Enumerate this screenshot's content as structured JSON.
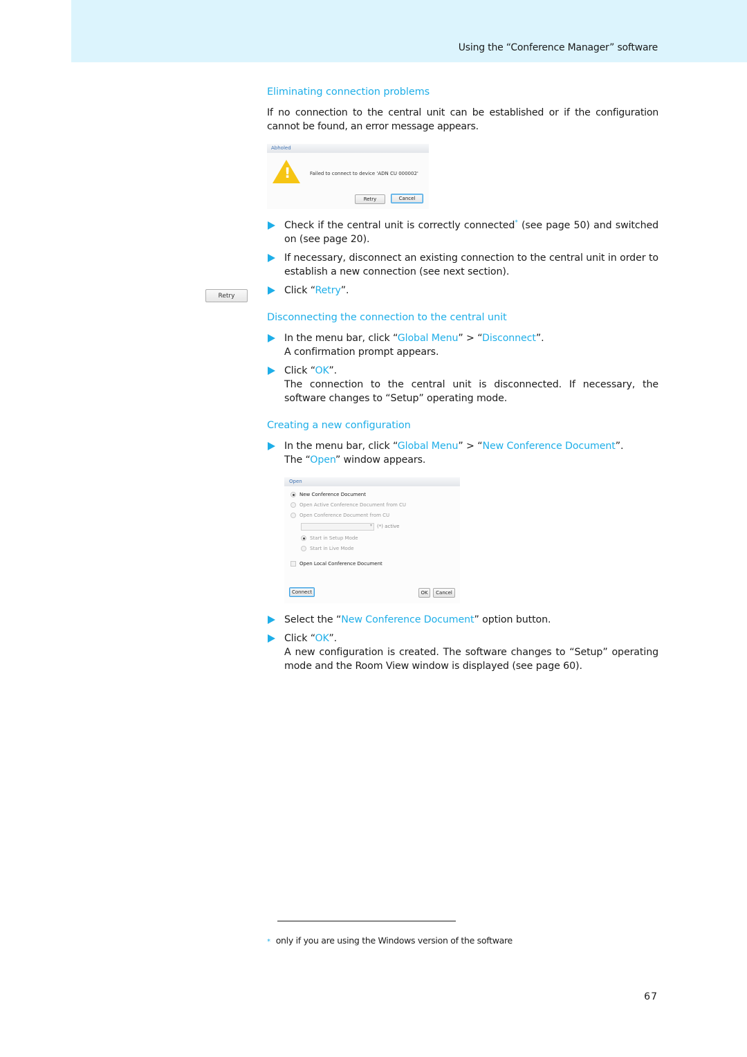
{
  "header": {
    "title": "Using the “Conference Manager” software"
  },
  "section1": {
    "heading": "Eliminating connection problems",
    "intro": "If no connection to the central unit can be established or if the configuration cannot be found, an error message appears.",
    "dialog": {
      "title": "Abholed",
      "message": "Failed to connect to device 'ADN CU 000002'",
      "retry_label": "Retry",
      "cancel_label": "Cancel"
    },
    "steps": [
      {
        "pre": "Check if the central unit is correctly connected",
        "sup": "*",
        "post": " (see page 50) and switched on (see page 20)."
      },
      {
        "text": "If necessary, disconnect an existing connection to the central unit in order to establish a new connection (see next section)."
      },
      {
        "pre": "Click “",
        "link": "Retry",
        "post": "”."
      }
    ],
    "margin_button": "Retry"
  },
  "section2": {
    "heading": "Disconnecting the connection to the central unit",
    "steps": [
      {
        "pre": "In the menu bar, click “",
        "link1": "Global Menu",
        "mid": "” > “",
        "link2": "Disconnect",
        "post": "”.",
        "result": "A confirmation prompt appears."
      },
      {
        "pre": "Click “",
        "link": "OK",
        "post": "”.",
        "result": "The connection to the central unit is disconnected. If necessary, the software changes to “Setup” operating mode."
      }
    ]
  },
  "section3": {
    "heading": "Creating a new configuration",
    "steps": [
      {
        "pre": "In the menu bar, click “",
        "link1": "Global Menu",
        "mid": "” > “",
        "link2": "New Conference Document",
        "post": "”.",
        "result_pre": "The “",
        "result_link": "Open",
        "result_post": "” window appears."
      },
      {
        "pre": "Select the “",
        "link": "New Conference Document",
        "post": "” option button."
      },
      {
        "pre": "Click “",
        "link": "OK",
        "post": "”.",
        "result": "A new configuration is created. The software changes to “Setup” operating mode and the Room View window is displayed (see page 60)."
      }
    ],
    "dialog": {
      "title": "Open",
      "options": [
        {
          "label": "New Conference Document",
          "selected": true,
          "enabled": true
        },
        {
          "label": "Open Active Conference Document from CU",
          "selected": false,
          "enabled": false
        },
        {
          "label": "Open Conference Document from CU",
          "selected": false,
          "enabled": false
        }
      ],
      "combo_value": "",
      "active_label": "(*) active",
      "mode_options": [
        {
          "label": "Start in Setup Mode",
          "selected": true
        },
        {
          "label": "Start in Live Mode",
          "selected": false
        }
      ],
      "local_label": "Open Local Conference Document",
      "connect_label": "Connect",
      "ok_label": "OK",
      "cancel_label": "Cancel"
    }
  },
  "footnote": {
    "marker": "*",
    "text": "only if you are using the Windows version of the software"
  },
  "page_number": "67",
  "colors": {
    "accent": "#1eaee8",
    "header_band": "#dcf4fd"
  }
}
